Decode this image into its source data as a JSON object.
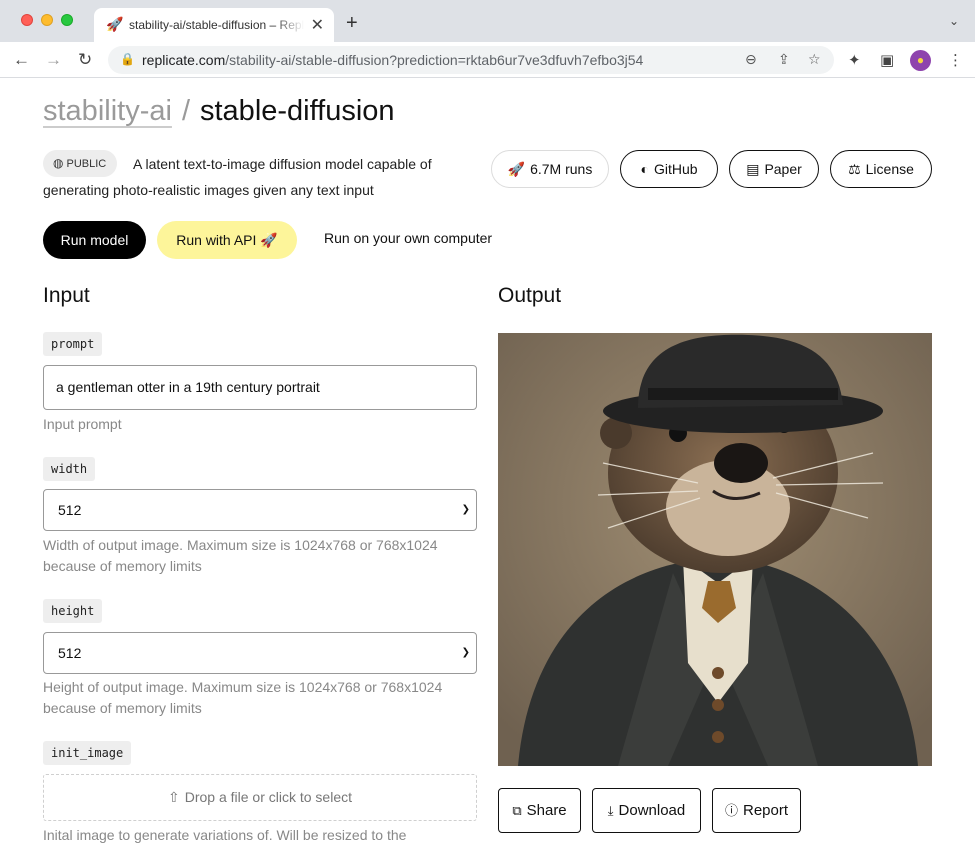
{
  "browser": {
    "tab_title": "stability-ai/stable-diffusion – Replicate",
    "tab_favicon": "🚀",
    "url_host": "replicate.com",
    "url_path": "/stability-ai/stable-diffusion?prediction=rktab6ur7ve3dfuvh7efbo3j54"
  },
  "model": {
    "owner": "stability-ai",
    "separator": "/",
    "name": "stable-diffusion",
    "visibility": "PUBLIC",
    "description": "A latent text-to-image diffusion model capable of generating photo-realistic images given any text input",
    "runs_label": "6.7M runs",
    "github_label": "GitHub",
    "paper_label": "Paper",
    "license_label": "License"
  },
  "actions": {
    "run_model": "Run model",
    "run_api": "Run with API 🚀",
    "run_own": "Run on your own computer"
  },
  "input": {
    "heading": "Input",
    "prompt": {
      "label": "prompt",
      "value": "a gentleman otter in a 19th century portrait",
      "help": "Input prompt"
    },
    "width": {
      "label": "width",
      "value": "512",
      "help": "Width of output image. Maximum size is 1024x768 or 768x1024 because of memory limits"
    },
    "height": {
      "label": "height",
      "value": "512",
      "help": "Height of output image. Maximum size is 1024x768 or 768x1024 because of memory limits"
    },
    "init_image": {
      "label": "init_image",
      "dropzone": "Drop a file or click to select",
      "help": "Inital image to generate variations of. Will be resized to the"
    }
  },
  "output": {
    "heading": "Output",
    "share": "Share",
    "download": "Download",
    "report": "Report"
  }
}
